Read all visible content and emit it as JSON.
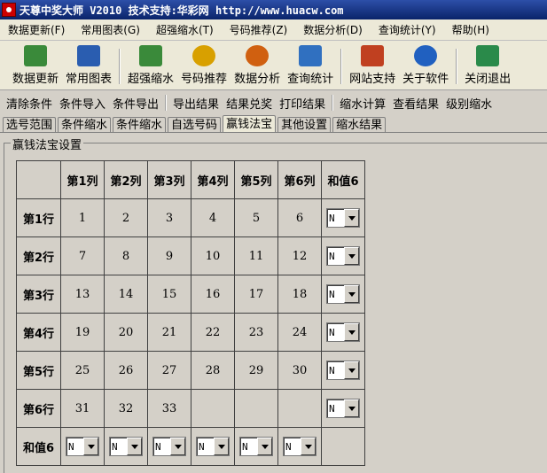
{
  "window": {
    "title": "天尊中奖大师 V2010 技术支持:华彩网 http://www.huacw.com"
  },
  "menu": [
    {
      "label": "数据更新(F)"
    },
    {
      "label": "常用图表(G)"
    },
    {
      "label": "超强缩水(T)"
    },
    {
      "label": "号码推荐(Z)"
    },
    {
      "label": "数据分析(D)"
    },
    {
      "label": "查询统计(Y)"
    },
    {
      "label": "帮助(H)"
    }
  ],
  "toolbar": [
    {
      "label": "数据更新",
      "icon": "database-icon",
      "color": "#3a8a3a"
    },
    {
      "label": "常用图表",
      "icon": "chart-icon",
      "color": "#2a5db0"
    },
    {
      "label": "超强缩水",
      "icon": "compress-icon",
      "color": "#3a8a3a"
    },
    {
      "label": "号码推荐",
      "icon": "coins-icon",
      "color": "#d8a000"
    },
    {
      "label": "数据分析",
      "icon": "gauge-icon",
      "color": "#d06010"
    },
    {
      "label": "查询统计",
      "icon": "table-icon",
      "color": "#3070c0"
    },
    {
      "label": "网站支持",
      "icon": "home-icon",
      "color": "#c04020"
    },
    {
      "label": "关于软件",
      "icon": "info-icon",
      "color": "#2060c0"
    },
    {
      "label": "关闭退出",
      "icon": "exit-icon",
      "color": "#2a8a4a"
    }
  ],
  "commands": {
    "group1": [
      "清除条件",
      "条件导入",
      "条件导出"
    ],
    "group2": [
      "导出结果",
      "结果兑奖",
      "打印结果"
    ],
    "group3": [
      "缩水计算",
      "查看结果",
      "级别缩水"
    ]
  },
  "tabs": [
    {
      "label": "选号范围",
      "active": false
    },
    {
      "label": "条件缩水",
      "active": false
    },
    {
      "label": "条件缩水",
      "active": false
    },
    {
      "label": "自选号码",
      "active": false
    },
    {
      "label": "赢钱法宝",
      "active": true
    },
    {
      "label": "其他设置",
      "active": false
    },
    {
      "label": "缩水结果",
      "active": false
    }
  ],
  "panel": {
    "group_title": "赢钱法宝设置",
    "col_headers": [
      "第1列",
      "第2列",
      "第3列",
      "第4列",
      "第5列",
      "第6列",
      "和值6"
    ],
    "rows": [
      {
        "label": "第1行",
        "cells": [
          "1",
          "2",
          "3",
          "4",
          "5",
          "6"
        ],
        "sum": "N"
      },
      {
        "label": "第2行",
        "cells": [
          "7",
          "8",
          "9",
          "10",
          "11",
          "12"
        ],
        "sum": "N"
      },
      {
        "label": "第3行",
        "cells": [
          "13",
          "14",
          "15",
          "16",
          "17",
          "18"
        ],
        "sum": "N"
      },
      {
        "label": "第4行",
        "cells": [
          "19",
          "20",
          "21",
          "22",
          "23",
          "24"
        ],
        "sum": "N"
      },
      {
        "label": "第5行",
        "cells": [
          "25",
          "26",
          "27",
          "28",
          "29",
          "30"
        ],
        "sum": "N"
      },
      {
        "label": "第6行",
        "cells": [
          "31",
          "32",
          "33",
          "",
          "",
          ""
        ],
        "sum": "N"
      }
    ],
    "sum_row": {
      "label": "和值6",
      "values": [
        "N",
        "N",
        "N",
        "N",
        "N",
        "N"
      ]
    }
  }
}
